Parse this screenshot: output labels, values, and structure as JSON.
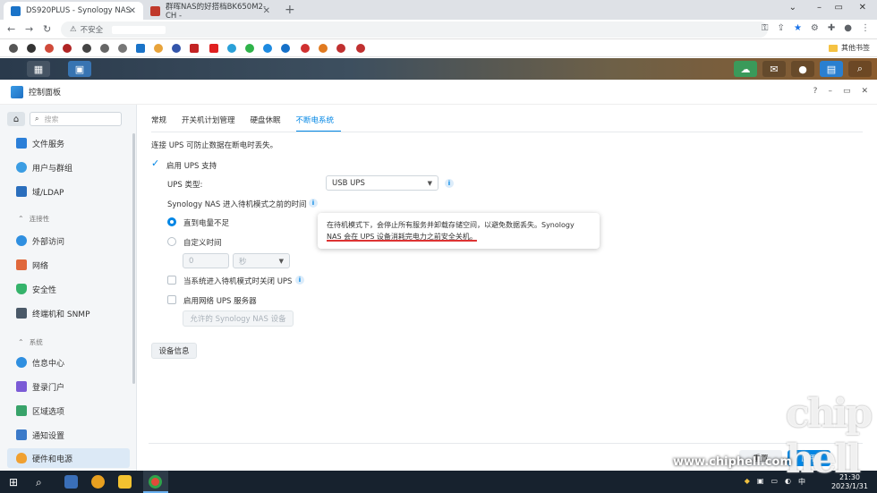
{
  "browser": {
    "tabs": [
      {
        "title": "DS920PLUS - Synology NAS",
        "active": true
      },
      {
        "title": "群晖NAS的好搭档BK650M2-CH -",
        "active": false
      }
    ],
    "security_label": "不安全",
    "bookmark_folder": "其他书签"
  },
  "window": {
    "title": "控制面板",
    "controls": [
      "?",
      "–",
      "▭",
      "✕"
    ]
  },
  "sidebar": {
    "search_placeholder": "搜索",
    "items": [
      {
        "label": "文件服务",
        "color": "#2b7fd8"
      },
      {
        "label": "用户与群组",
        "color": "#3b9de3"
      },
      {
        "label": "域/LDAP",
        "color": "#2a6ebd"
      },
      {
        "section": "连接性"
      },
      {
        "label": "外部访问",
        "color": "#2f8fe0"
      },
      {
        "label": "网络",
        "color": "#e0683c"
      },
      {
        "label": "安全性",
        "color": "#35b36b"
      },
      {
        "label": "终端机和 SNMP",
        "color": "#4a5968"
      },
      {
        "section": "系统"
      },
      {
        "label": "信息中心",
        "color": "#2f8fe0"
      },
      {
        "label": "登录门户",
        "color": "#7b5bd6"
      },
      {
        "label": "区域选项",
        "color": "#38a36a"
      },
      {
        "label": "通知设置",
        "color": "#3b7ac9"
      },
      {
        "label": "硬件和电源",
        "color": "#f0a030",
        "active": true
      }
    ]
  },
  "tabs": [
    "常规",
    "开关机计划管理",
    "硬盘休眠",
    "不断电系统"
  ],
  "active_tab": 3,
  "ups": {
    "description": "连接 UPS 可防止数据在断电时丢失。",
    "enable_label": "启用 UPS 支持",
    "enabled": true,
    "type_label": "UPS 类型:",
    "type_value": "USB UPS",
    "standby_label": "Synology NAS 进入待机模式之前的时间",
    "radio_low_battery": "直到电量不足",
    "radio_custom": "自定义时间",
    "custom_time_value": "0",
    "custom_time_unit": "秒",
    "shutdown_label": "当系统进入待机模式时关闭 UPS",
    "network_server_label": "启用网络 UPS 服务器",
    "allowed_devices_button": "允许的 Synology NAS 设备",
    "device_info_button": "设备信息"
  },
  "tooltip": {
    "line1": "在待机模式下，会停止所有服务并卸载存储空间，以避免数据丢失。Synology",
    "line2": "NAS 会在 UPS 设备消耗完电力之前安全关机。"
  },
  "footer": {
    "reset_label": "重置",
    "apply_label": "应用"
  },
  "taskbar": {
    "time": "21:30",
    "date": "2023/1/31",
    "ime": "中"
  },
  "watermark": {
    "site": "www.chiphell.com",
    "logo": "chip hell"
  },
  "colors": {
    "accent": "#0086e5"
  }
}
